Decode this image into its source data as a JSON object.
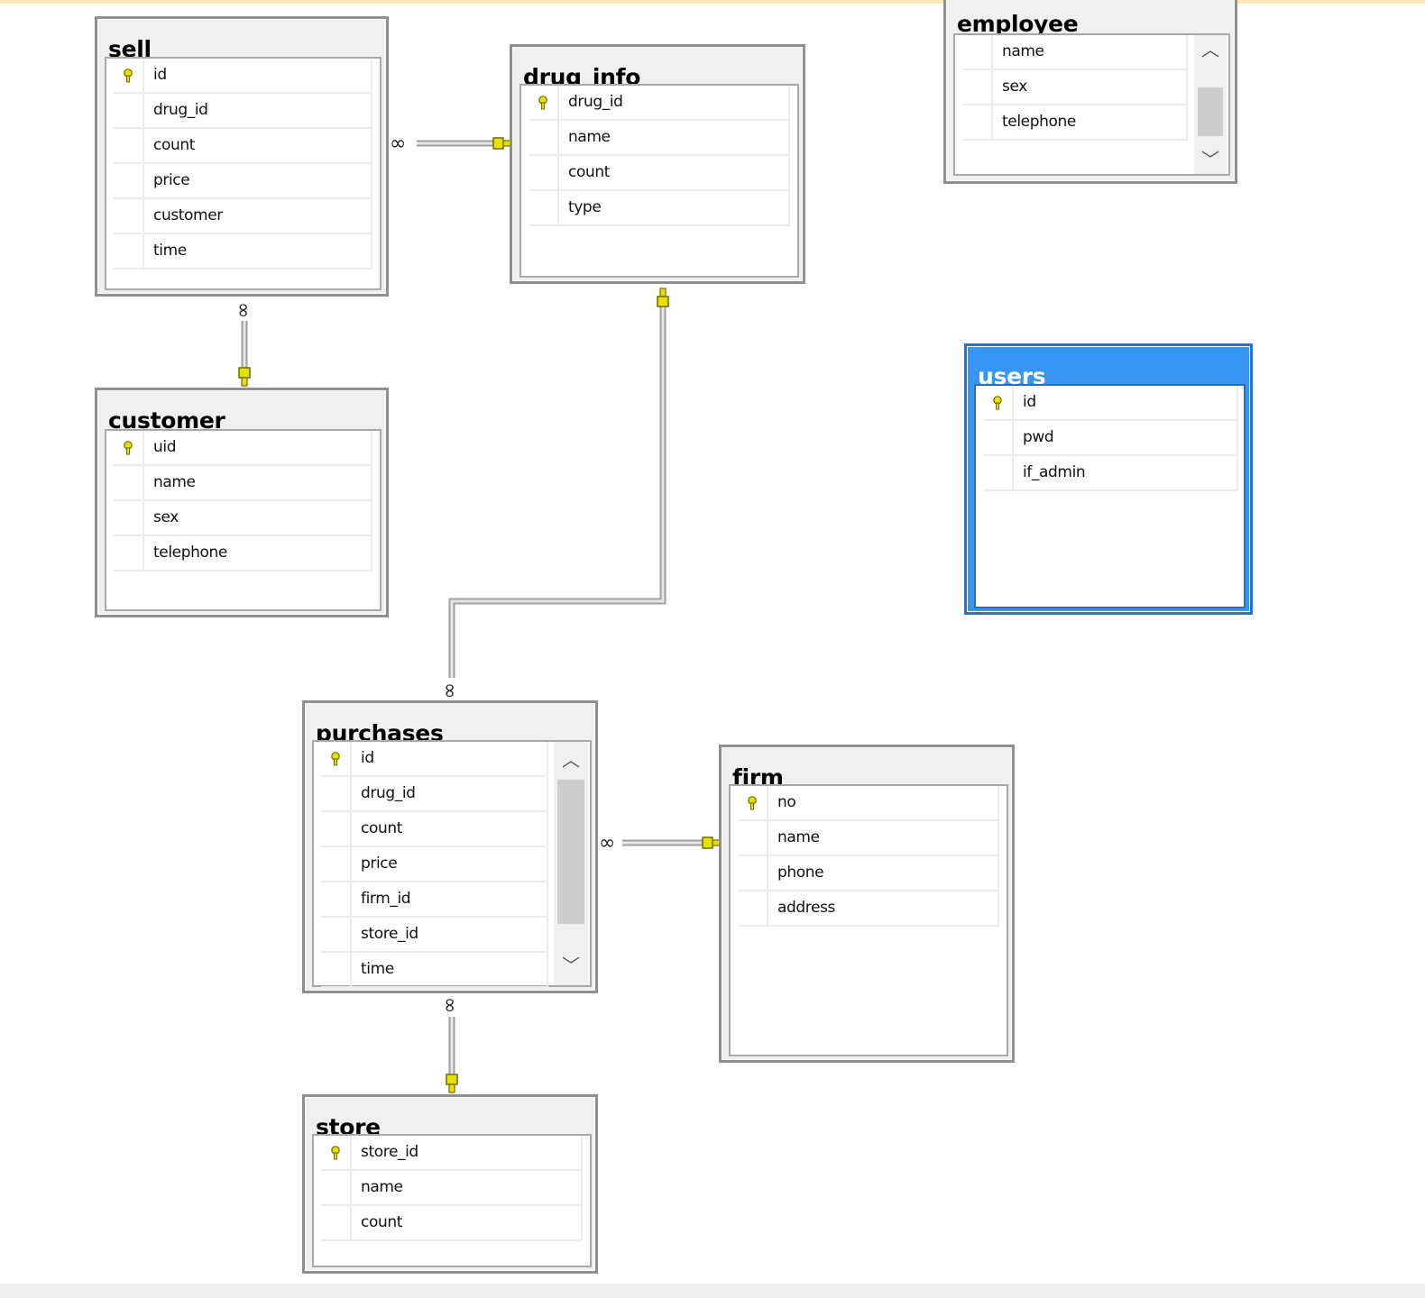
{
  "diagram": {
    "tables": {
      "sell": {
        "title": "sell",
        "columns": [
          "id",
          "drug_id",
          "count",
          "price",
          "customer",
          "time"
        ],
        "primary_key": "id"
      },
      "drug_info": {
        "title": "drug_info",
        "columns": [
          "drug_id",
          "name",
          "count",
          "type"
        ],
        "primary_key": "drug_id"
      },
      "employee": {
        "title": "employee",
        "columns": [
          "name",
          "sex",
          "telephone"
        ],
        "primary_key": ""
      },
      "users": {
        "title": "users",
        "columns": [
          "id",
          "pwd",
          "if_admin"
        ],
        "primary_key": "id",
        "selected": true
      },
      "customer": {
        "title": "customer",
        "columns": [
          "uid",
          "name",
          "sex",
          "telephone"
        ],
        "primary_key": "uid"
      },
      "purchases": {
        "title": "purchases",
        "columns": [
          "id",
          "drug_id",
          "count",
          "price",
          "firm_id",
          "store_id",
          "time"
        ],
        "primary_key": "id"
      },
      "firm": {
        "title": "firm",
        "columns": [
          "no",
          "name",
          "phone",
          "address"
        ],
        "primary_key": "no"
      },
      "store": {
        "title": "store",
        "columns": [
          "store_id",
          "name",
          "count"
        ],
        "primary_key": "store_id"
      }
    },
    "relationships": [
      {
        "from": "sell",
        "to": "drug_info",
        "many_end": "sell",
        "key_end": "drug_info"
      },
      {
        "from": "sell",
        "to": "customer",
        "many_end": "sell",
        "key_end": "customer"
      },
      {
        "from": "purchases",
        "to": "drug_info",
        "many_end": "purchases",
        "key_end": "drug_info"
      },
      {
        "from": "purchases",
        "to": "firm",
        "many_end": "purchases",
        "key_end": "firm"
      },
      {
        "from": "purchases",
        "to": "store",
        "many_end": "purchases",
        "key_end": "store"
      }
    ],
    "colors": {
      "selected_table": "#3795f3",
      "key_icon": "#e8e000",
      "connector": "#a0a0a0"
    },
    "icons": [
      "primary-key-icon",
      "chevron-up-icon",
      "chevron-down-icon",
      "infinity-icon"
    ]
  }
}
